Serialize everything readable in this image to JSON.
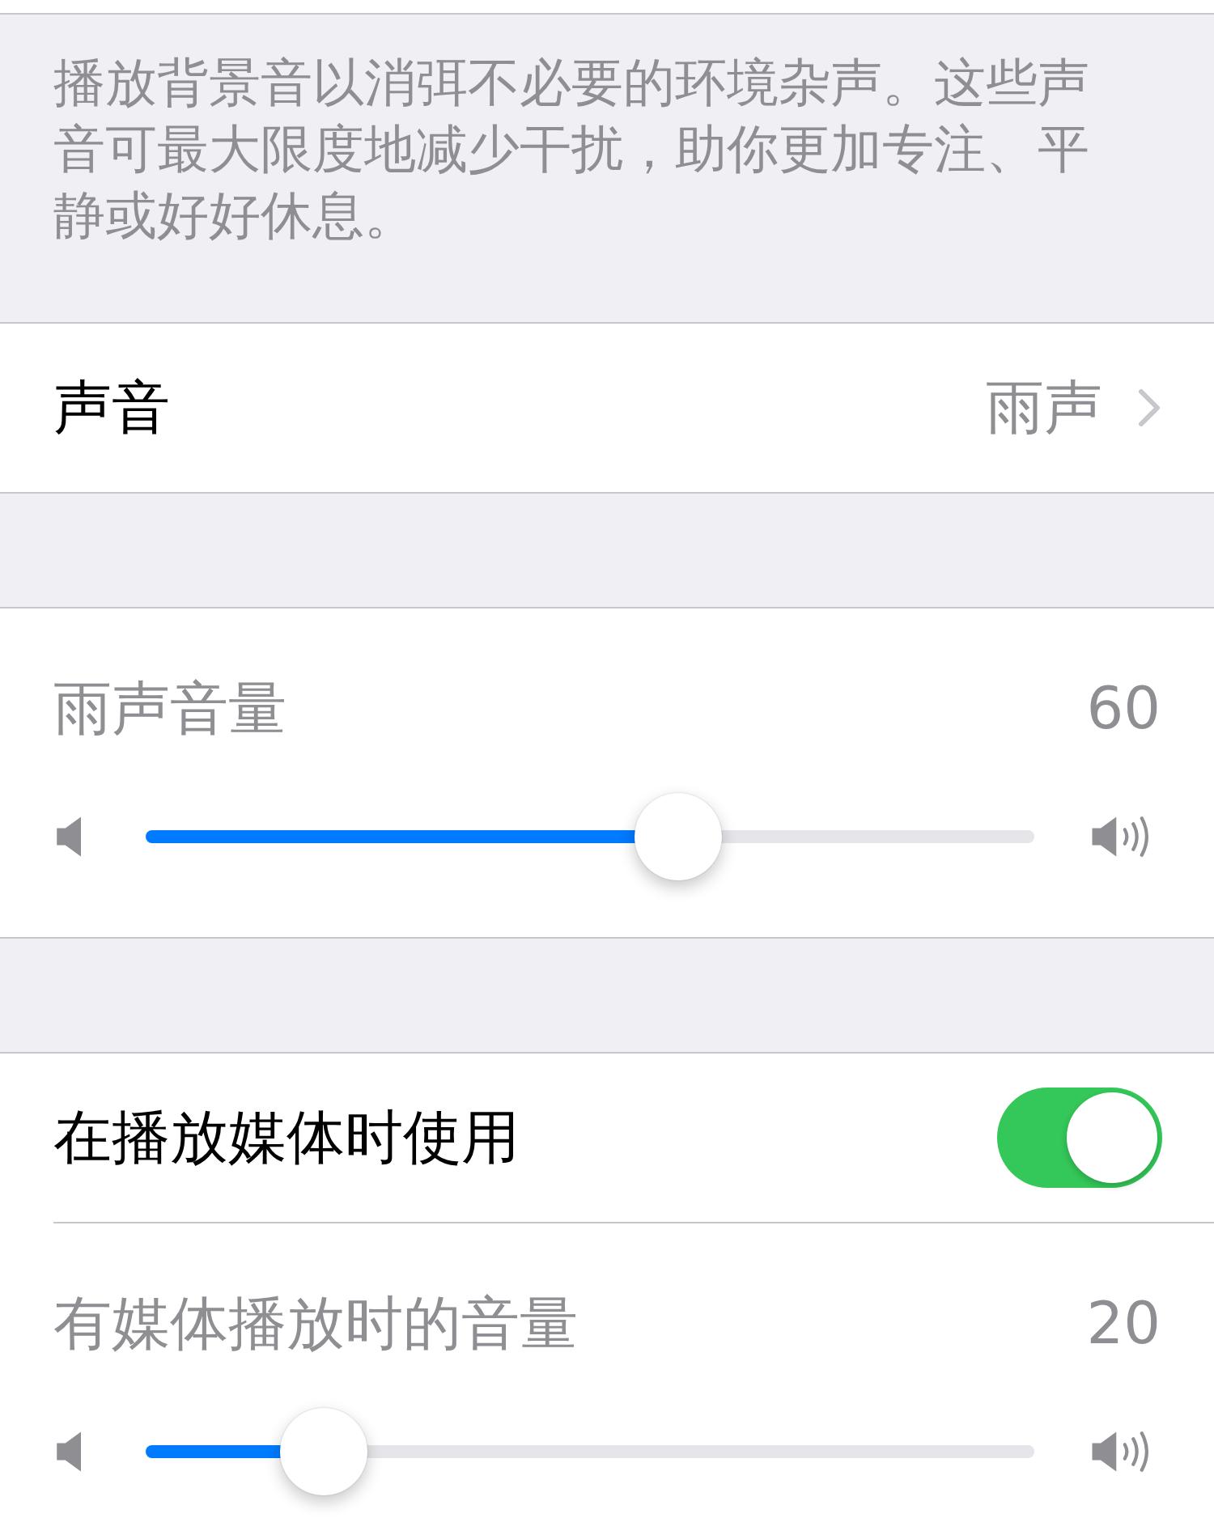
{
  "description": "播放背景音以消弭不必要的环境杂声。这些声音可最大限度地减少干扰，助你更加专注、平静或好好休息。",
  "sound_row": {
    "label": "声音",
    "value": "雨声"
  },
  "rain_volume": {
    "label": "雨声音量",
    "reading": "60",
    "level": 0.6
  },
  "media_toggle": {
    "label": "在播放媒体时使用",
    "on": true
  },
  "media_volume": {
    "label": "有媒体播放时的音量",
    "reading": "20",
    "level": 0.2
  }
}
